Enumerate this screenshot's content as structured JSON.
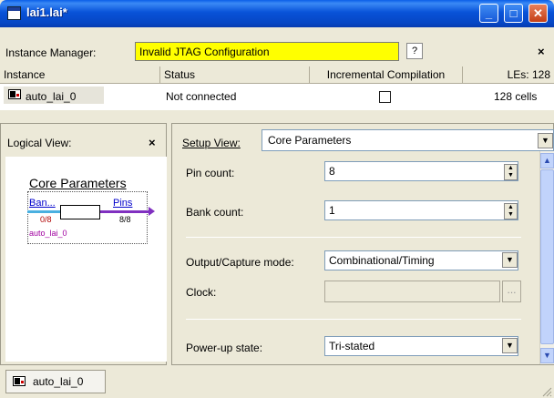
{
  "window": {
    "title": "lai1.lai*",
    "minimize_label": "_",
    "maximize_label": "□",
    "close_label": "✕"
  },
  "instance_manager": {
    "label": "Instance Manager:",
    "status": "Invalid JTAG Configuration",
    "help_label": "?",
    "close_label": "×"
  },
  "table": {
    "headers": [
      "Instance",
      "Status",
      "Incremental Compilation",
      "LEs: 128"
    ],
    "rows": [
      {
        "instance": "auto_lai_0",
        "status": "Not connected",
        "incremental": false,
        "les": "128 cells"
      }
    ]
  },
  "logical_view": {
    "title": "Logical View:",
    "close_label": "×",
    "diagram": {
      "title": "Core Parameters",
      "bank_label": "Ban...",
      "pins_label": "Pins",
      "bank_count": "0/8",
      "pins_count": "8/8",
      "instance": "auto_lai_0"
    }
  },
  "setup_view": {
    "label": "Setup View:",
    "selected": "Core Parameters"
  },
  "fields": {
    "pin_count_label": "Pin count:",
    "pin_count_value": "8",
    "bank_count_label": "Bank count:",
    "bank_count_value": "1",
    "output_mode_label": "Output/Capture mode:",
    "output_mode_value": "Combinational/Timing",
    "clock_label": "Clock:",
    "clock_browse": "...",
    "powerup_label": "Power-up state:",
    "powerup_value": "Tri-stated"
  },
  "bottom_tab": {
    "label": "auto_lai_0"
  },
  "colors": {
    "status_highlight": "#ffff00",
    "title_bar": "#0852d8"
  }
}
